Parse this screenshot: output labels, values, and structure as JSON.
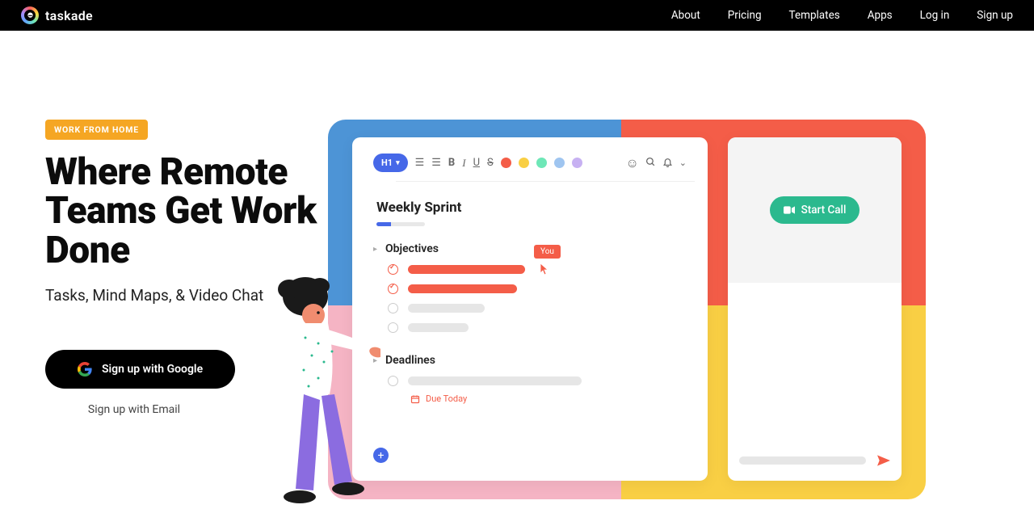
{
  "brand": {
    "name": "taskade"
  },
  "nav": {
    "about": "About",
    "pricing": "Pricing",
    "templates": "Templates",
    "apps": "Apps",
    "login": "Log in",
    "signup": "Sign up"
  },
  "hero": {
    "badge": "WORK FROM HOME",
    "headline": "Where Remote Teams Get Work Done",
    "tagline": "Tasks, Mind Maps, & Video Chat",
    "google_cta": "Sign up with Google",
    "email_cta": "Sign up with Email"
  },
  "mock": {
    "heading_chip": "H1",
    "doc_title": "Weekly Sprint",
    "section_objectives": "Objectives",
    "section_deadlines": "Deadlines",
    "you_label": "You",
    "due_today": "Due Today",
    "start_call": "Start Call",
    "toolbar_icons": {
      "bold": "B",
      "italic": "I",
      "underline": "U",
      "strike": "S"
    },
    "dot_colors": [
      "#f45d48",
      "#f9cf44",
      "#6ee7b7",
      "#9fc5f0",
      "#c7b1f2"
    ]
  }
}
